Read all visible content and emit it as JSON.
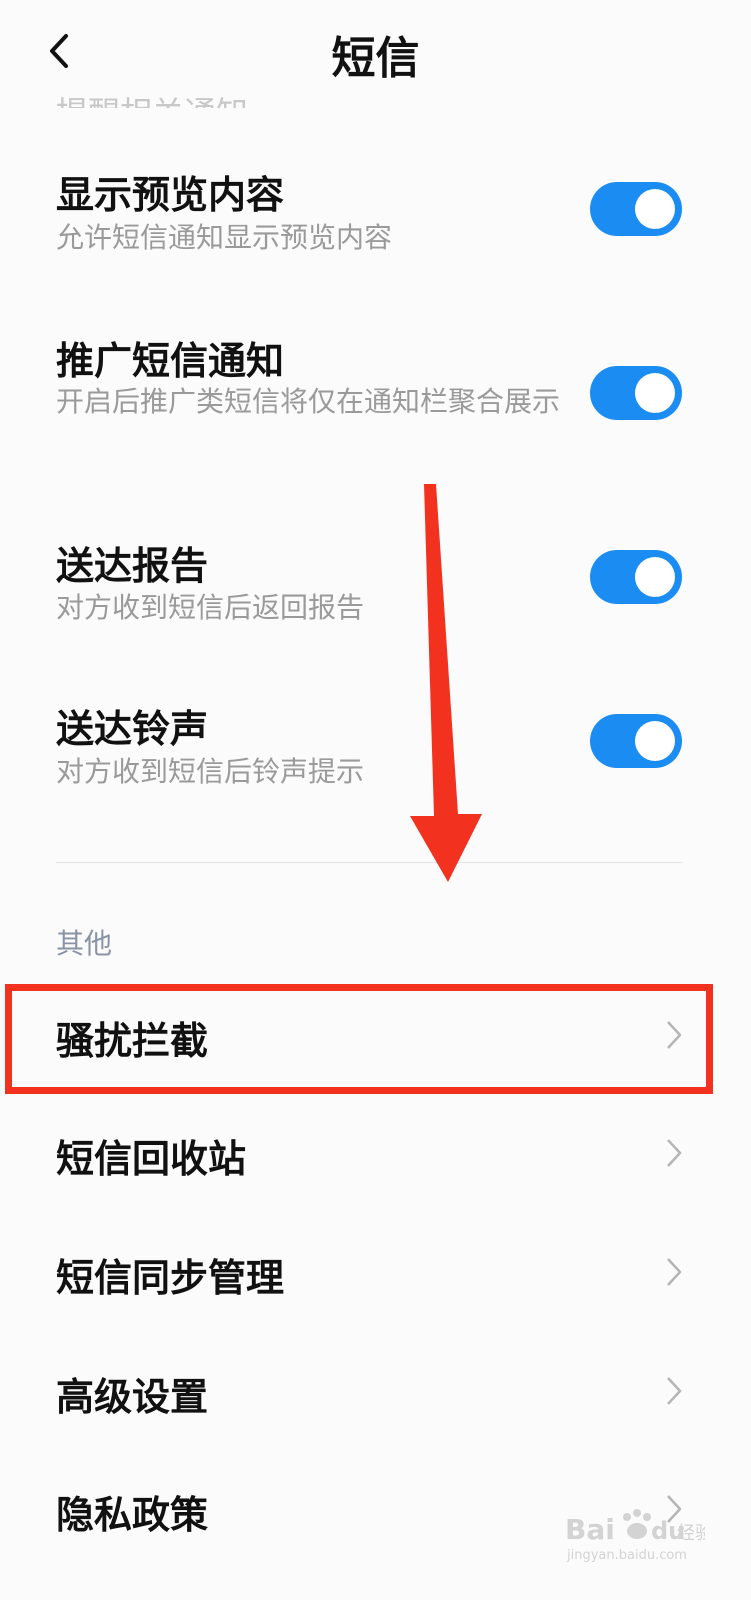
{
  "header": {
    "title": "短信"
  },
  "clipped_top_text": "提醒相关通知",
  "toggles": [
    {
      "title": "显示预览内容",
      "desc": "允许短信通知显示预览内容",
      "on": true
    },
    {
      "title": "推广短信通知",
      "desc": "开启后推广类短信将仅在通知栏聚合展示",
      "on": true
    },
    {
      "title": "送达报告",
      "desc": "对方收到短信后返回报告",
      "on": true
    },
    {
      "title": "送达铃声",
      "desc": "对方收到短信后铃声提示",
      "on": true
    }
  ],
  "section": {
    "label": "其他"
  },
  "nav_items": [
    {
      "label": "骚扰拦截"
    },
    {
      "label": "短信回收站"
    },
    {
      "label": "短信同步管理"
    },
    {
      "label": "高级设置"
    },
    {
      "label": "隐私政策"
    }
  ],
  "watermark": {
    "brand": "Bai",
    "suffix": "du",
    "cn": "经验",
    "url": "jingyan.baidu.com"
  },
  "colors": {
    "accent": "#1a8cf2",
    "annotation": "#f2321f",
    "section_label": "#8a93a6"
  }
}
